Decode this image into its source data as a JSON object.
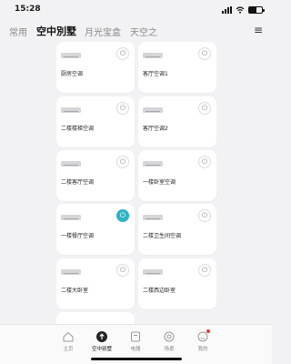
{
  "status": {
    "time": "15:28",
    "battery_level": 0.6
  },
  "tabs": [
    "常用",
    "空中別墅",
    "月光宝盒",
    "天空之"
  ],
  "active_tab": 1,
  "devices": [
    {
      "name": "厨房空调",
      "power": "off"
    },
    {
      "name": "客厅空调1",
      "power": "off"
    },
    {
      "name": "二楼楼梯空调",
      "power": "off"
    },
    {
      "name": "客厅空调2",
      "power": "off"
    },
    {
      "name": "二楼客厅空调",
      "power": "off"
    },
    {
      "name": "一楼卧室空调",
      "power": "off"
    },
    {
      "name": "一楼餐厅空调",
      "power": "on"
    },
    {
      "name": "二楼卫生间空调",
      "power": "off"
    },
    {
      "name": "二楼大卧室",
      "power": "off"
    },
    {
      "name": "二楼西边卧室",
      "power": "off"
    }
  ],
  "nav": [
    "主页",
    "空中别墅",
    "电器",
    "场景",
    "我的"
  ],
  "nav_active": 1
}
